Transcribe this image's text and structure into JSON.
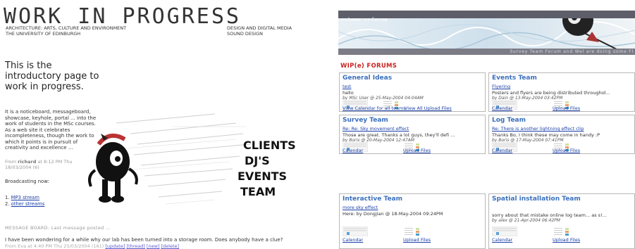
{
  "left": {
    "title": "WORK IN PROGRESS",
    "subtitle_left": [
      "ARCHITECTURE: ARTS, CULTURE AND ENVIRONMENT",
      "THE UNIVERSITY OF EDINBURGH"
    ],
    "subtitle_right": [
      "DESIGN AND DIGITAL MEDIA",
      "SOUND DESIGN"
    ],
    "intro": "This is the introductory page to work in progress.",
    "description": "It is a noticeboard, messageboard, showcase, keyhole, portal ... into the work of students in the MSc courses. As a web site it celebrates incompleteness, though the work to which it points is in pursuit of creativity and excellence ...",
    "from_prefix": "From",
    "from_name": "richard",
    "from_date": "at 8:12 PM Thu 18/03/2004 (6)",
    "broadcast": "Broadcasting now:",
    "streams": [
      {
        "num": "1.",
        "label": "MP3 stream"
      },
      {
        "num": "2.",
        "label": "other streams"
      }
    ],
    "message_board": "MESSAGE BOARD: Last message posted ...",
    "message_text": "I have been wondering for a while why our lab has been turned into a storage room. Does anybody have a clue?",
    "message_meta": "From Eva at 4:40 PM Thu 25/03/2004 (161)",
    "message_links": [
      "[update]",
      "[thread]",
      "[new]",
      "[delete]"
    ],
    "graphic_words": [
      "CLIENTS",
      "DJ'S",
      "EVENTS",
      "TEAM"
    ]
  },
  "right": {
    "nav": ">>home  >>forum",
    "ticker": "Survey Team Forum and Wel are doing some Fl",
    "forums_title": "WIP(e) FORUMS",
    "cards": [
      {
        "title": "General Ideas",
        "topic": "test",
        "snippet": "hello",
        "by": "by MSc User @ 25-May-2004 04:04AM",
        "link1": "View Calendar for all teams",
        "link2": "View All Upload Files"
      },
      {
        "title": "Events Team",
        "topic": "Flyering",
        "snippet": "Posters and flyers are being distributed throughol...",
        "by": "by Dain @ 13-May-2004 03:42PM",
        "link1": "Calendar",
        "link2": "Upload Files"
      },
      {
        "title": "Survey Team",
        "topic": "Re: Re: Sky movement effect",
        "snippet": "Those are great. Thanks a lot guys, they'll defi ...",
        "by": "by Boris @ 20-May-2004 12:47AM",
        "link1": "Calendar",
        "link2": "Upload Files"
      },
      {
        "title": "Log Team",
        "topic": "Re: There is another lightning effect clip",
        "snippet": "Thanks Bo, I think these may come in handy :P",
        "by": "by Boris @ 17-May-2004 07:41PM",
        "link1": "Calendar",
        "link2": "Upload Files"
      },
      {
        "title": "Interactive Team",
        "topic": "more sky effect",
        "snippet": "Here: by Dongjian @ 18-May-2004 09:24PM",
        "by": "",
        "link1": "Calendar",
        "link2": "Upload Files"
      },
      {
        "title": "Spatial installation Team",
        "topic": "",
        "snippet": "sorry about that mistake online log team... as s!...",
        "by": "by alex @ 21-Apr-2004 06:42PM",
        "link1": "Calendar",
        "link2": "Upload Files"
      }
    ]
  }
}
